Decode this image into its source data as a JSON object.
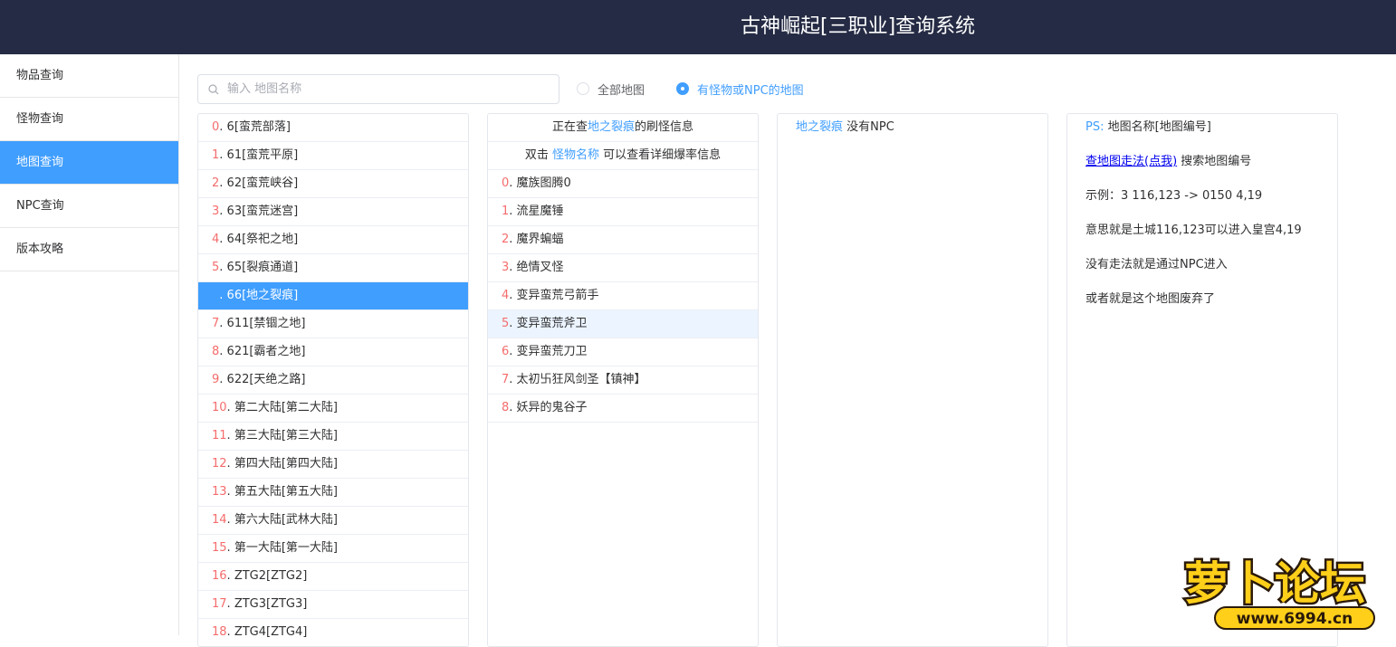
{
  "header": {
    "title": "古神崛起[三职业]查询系统"
  },
  "sidebar": {
    "items": [
      "物品查询",
      "怪物查询",
      "地图查询",
      "NPC查询",
      "版本攻略"
    ],
    "active_index": 2
  },
  "search": {
    "placeholder": "输入 地图名称",
    "value": ""
  },
  "radios": {
    "all": "全部地图",
    "npc": "有怪物或NPC的地图",
    "selected": "npc"
  },
  "maps": {
    "active_index": 6,
    "items": [
      {
        "i": "0",
        "name": "6[蛮荒部落]"
      },
      {
        "i": "1",
        "name": "61[蛮荒平原]"
      },
      {
        "i": "2",
        "name": "62[蛮荒峡谷]"
      },
      {
        "i": "3",
        "name": "63[蛮荒迷宫]"
      },
      {
        "i": "4",
        "name": "64[祭祀之地]"
      },
      {
        "i": "5",
        "name": "65[裂痕通道]"
      },
      {
        "i": "6",
        "name": "66[地之裂痕]"
      },
      {
        "i": "7",
        "name": "611[禁锢之地]"
      },
      {
        "i": "8",
        "name": "621[霸者之地]"
      },
      {
        "i": "9",
        "name": "622[天绝之路]"
      },
      {
        "i": "10",
        "name": "第二大陆[第二大陆]"
      },
      {
        "i": "11",
        "name": "第三大陆[第三大陆]"
      },
      {
        "i": "12",
        "name": "第四大陆[第四大陆]"
      },
      {
        "i": "13",
        "name": "第五大陆[第五大陆]"
      },
      {
        "i": "14",
        "name": "第六大陆[武林大陆]"
      },
      {
        "i": "15",
        "name": "第一大陆[第一大陆]"
      },
      {
        "i": "16",
        "name": "ZTG2[ZTG2]"
      },
      {
        "i": "17",
        "name": "ZTG3[ZTG3]"
      },
      {
        "i": "18",
        "name": "ZTG4[ZTG4]"
      }
    ]
  },
  "monsters": {
    "header_prefix": "正在查",
    "header_map": "地之裂痕",
    "header_suffix": "的刷怪信息",
    "tip_prefix": "双击 ",
    "tip_link": "怪物名称",
    "tip_suffix": " 可以查看详细爆率信息",
    "hover_index": 5,
    "items": [
      {
        "i": "0",
        "name": "魔族图腾0"
      },
      {
        "i": "1",
        "name": "流星魔锤"
      },
      {
        "i": "2",
        "name": "魔界蝙蝠"
      },
      {
        "i": "3",
        "name": "绝情叉怪"
      },
      {
        "i": "4",
        "name": "变异蛮荒弓箭手"
      },
      {
        "i": "5",
        "name": "变异蛮荒斧卫"
      },
      {
        "i": "6",
        "name": "变异蛮荒刀卫"
      },
      {
        "i": "7",
        "name": "太初卐狂风剑圣【镇神】"
      },
      {
        "i": "8",
        "name": "妖异的鬼谷子"
      }
    ]
  },
  "npc": {
    "map": "地之裂痕",
    "text": " 没有NPC"
  },
  "info": {
    "ps_label": "PS:",
    "ps_text": " 地图名称[地图编号]",
    "link_text": "查地图走法(点我)",
    "link_suffix": " 搜索地图编号",
    "example": "示例：3 116,123 -> 0150 4,19",
    "meaning": "意思就是土城116,123可以进入皇宫4,19",
    "no_path": "没有走法就是通过NPC进入",
    "abandoned": "或者就是这个地图废弃了"
  },
  "watermark": {
    "brand": "萝卜论坛",
    "url": "www.6994.cn"
  },
  "colors": {
    "header_bg": "#252b44",
    "accent": "#409eff",
    "index_red": "#f56c6c",
    "border": "#ebeef5"
  }
}
